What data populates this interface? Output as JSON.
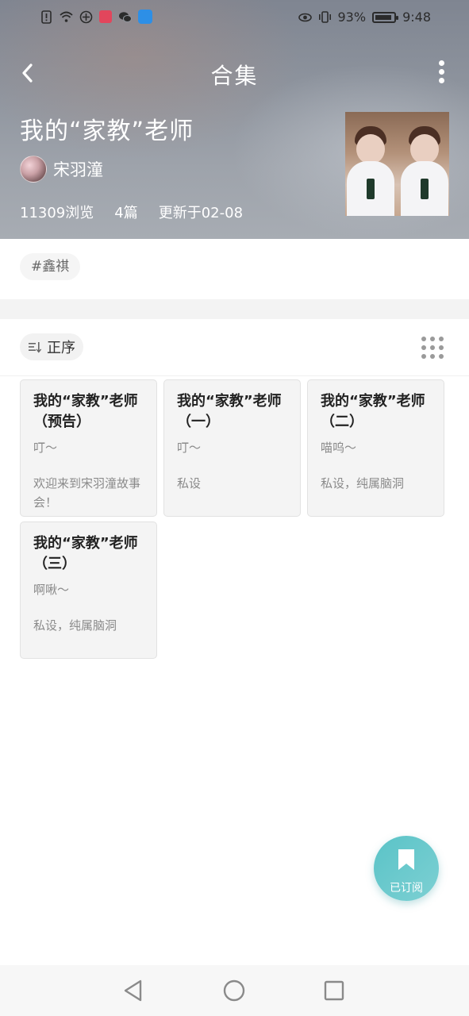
{
  "status_bar": {
    "battery_percent": "93%",
    "battery_level": 0.93,
    "time": "9:48"
  },
  "header": {
    "title": "合集",
    "back_icon": "chevron-left-icon",
    "more_icon": "more-vertical-icon"
  },
  "collection": {
    "title": "我的“家教”老师",
    "author": "宋羽潼",
    "views": "11309浏览",
    "count": "4篇",
    "updated": "更新于02-08"
  },
  "tags": [
    "#鑫祺"
  ],
  "sort": {
    "label": "正序",
    "icon": "sort-icon",
    "layout_icon": "grid-dots-icon"
  },
  "articles": [
    {
      "title": "我的“家教”老师（预告）",
      "subtitle": "叮～",
      "desc": "欢迎来到宋羽潼故事会！"
    },
    {
      "title": "我的“家教”老师（一）",
      "subtitle": "叮～",
      "desc": "私设"
    },
    {
      "title": "我的“家教”老师（二）",
      "subtitle": "喵呜～",
      "desc": "私设，纯属脑洞"
    },
    {
      "title": "我的“家教”老师（三）",
      "subtitle": "啊啾～",
      "desc": "私设，纯属脑洞"
    }
  ],
  "subscribe": {
    "label": "已订阅",
    "icon": "bookmark-icon",
    "color": "#5ac3c7"
  },
  "nav": {
    "back_icon": "nav-back-icon",
    "home_icon": "nav-home-icon",
    "recents_icon": "nav-recents-icon"
  }
}
